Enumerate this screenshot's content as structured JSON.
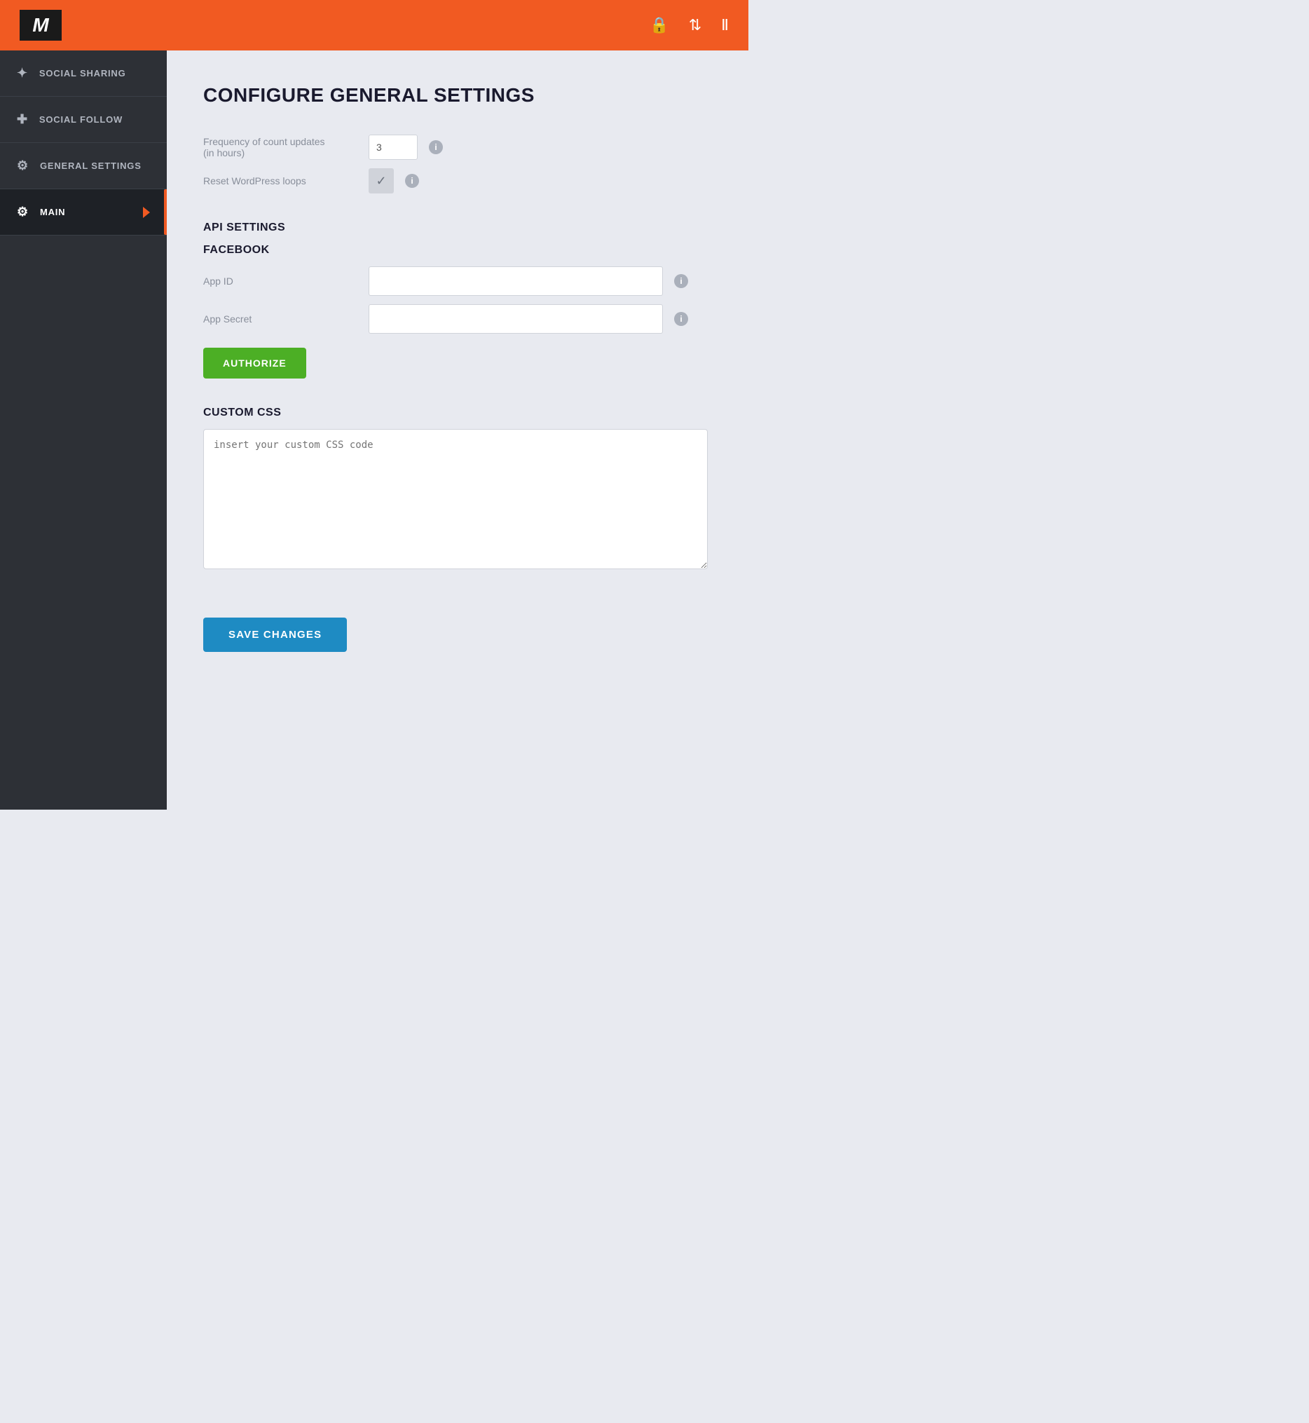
{
  "header": {
    "logo": "M",
    "icons": [
      "lock-icon",
      "user-settings-icon",
      "chart-icon"
    ]
  },
  "sidebar": {
    "items": [
      {
        "id": "social-sharing",
        "label": "Social Sharing",
        "icon": "share"
      },
      {
        "id": "social-follow",
        "label": "Social Follow",
        "icon": "plus"
      },
      {
        "id": "general-settings",
        "label": "General Settings",
        "icon": "gear"
      },
      {
        "id": "main",
        "label": "Main",
        "icon": "gear",
        "active": true
      }
    ]
  },
  "main": {
    "page_title": "Configure General Settings",
    "general_section": {
      "frequency_label": "Frequency of count updates\n(in hours)",
      "frequency_value": "3",
      "reset_label": "Reset WordPress loops"
    },
    "api_section": {
      "title": "API Settings",
      "facebook_title": "Facebook",
      "app_id_label": "App ID",
      "app_id_placeholder": "",
      "app_secret_label": "App Secret",
      "app_secret_placeholder": "",
      "authorize_label": "Authorize"
    },
    "custom_css_section": {
      "title": "Custom CSS",
      "placeholder": "insert your custom CSS code"
    },
    "save_button_label": "Save Changes"
  }
}
